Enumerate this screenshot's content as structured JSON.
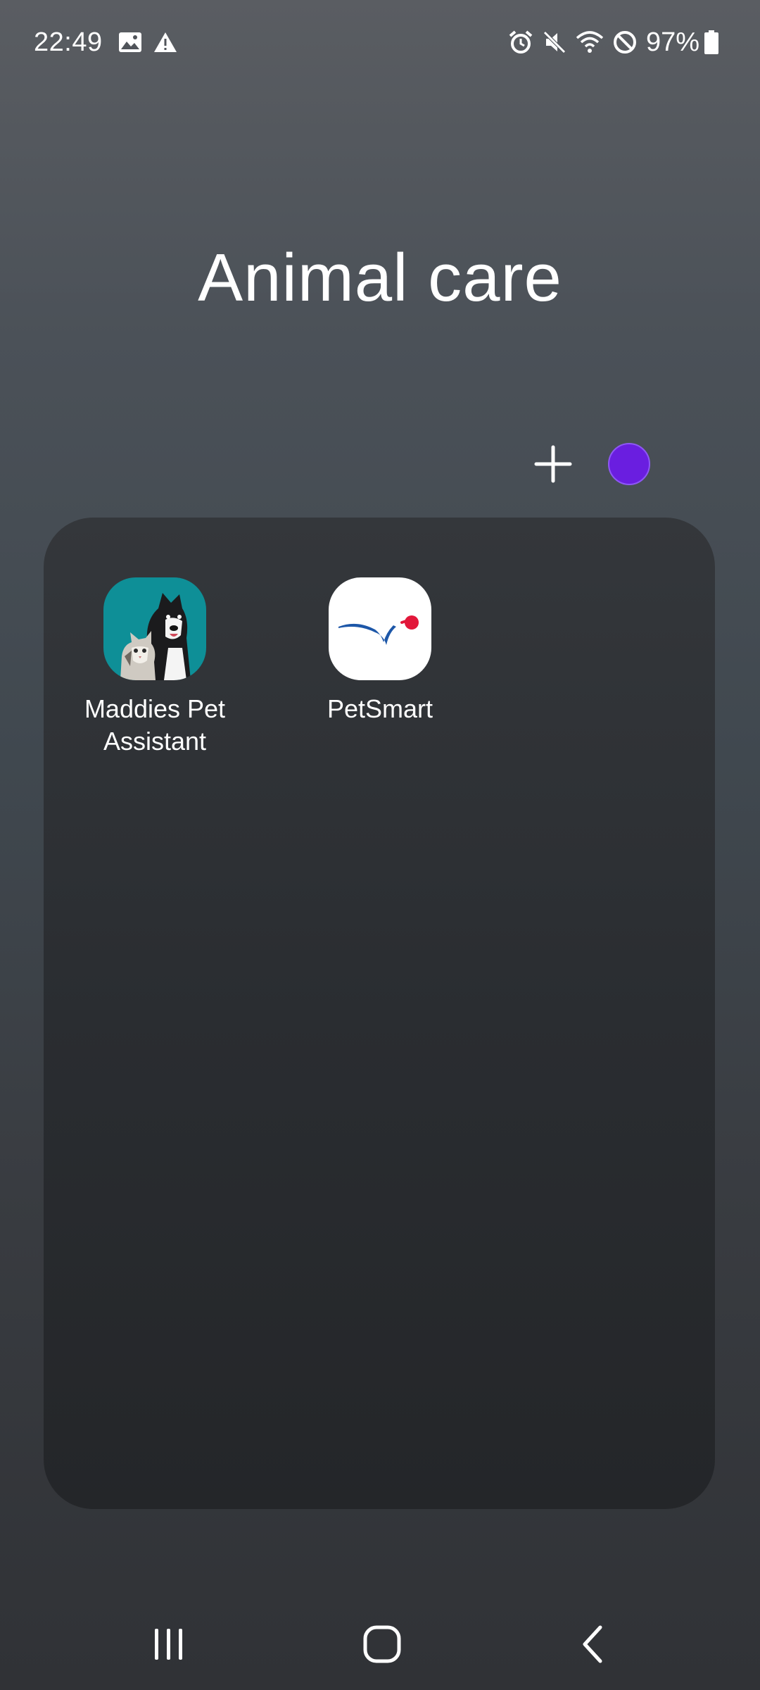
{
  "status_bar": {
    "time": "22:49",
    "battery": "97%",
    "icons": [
      "image-icon",
      "warning-icon",
      "alarm-icon",
      "mute-icon",
      "wifi-icon",
      "do-not-disturb-icon",
      "battery-icon"
    ]
  },
  "folder": {
    "title": "Animal care",
    "color": "#6a1ee0",
    "apps": [
      {
        "label": "Maddies Pet Assistant",
        "icon": "maddies-pet-assistant-icon"
      },
      {
        "label": "PetSmart",
        "icon": "petsmart-icon"
      }
    ]
  },
  "nav": {
    "buttons": [
      "recents-icon",
      "home-icon",
      "back-icon"
    ]
  }
}
